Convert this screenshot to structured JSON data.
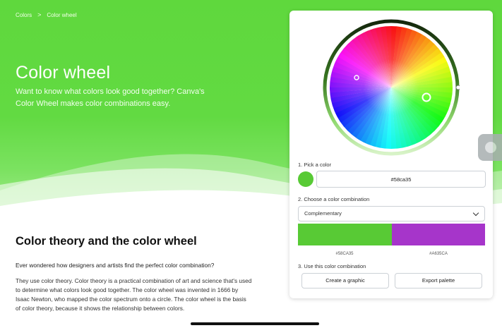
{
  "breadcrumb": {
    "root": "Colors",
    "separator": ">",
    "current": "Color wheel"
  },
  "hero": {
    "title": "Color wheel",
    "subtitle": "Want to know what colors look good together? Canva's Color Wheel makes color combinations easy."
  },
  "theory": {
    "title": "Color theory and the color wheel",
    "intro": "Ever wondered how designers and artists find the perfect color combination?",
    "body": "They use color theory. Color theory is a practical combination of art and science that's used to determine what colors look good together. The color wheel was invented in 1666 by Isaac Newton, who mapped the color spectrum onto a circle. The color wheel is the basis of color theory, because it shows the relationship between colors."
  },
  "picker": {
    "step1_label": "1. Pick a color",
    "hex_value": "#58ca35",
    "swatch_color": "#58ca35",
    "step2_label": "2. Choose a color combination",
    "combination_selected": "Complementary",
    "palette": [
      {
        "hex": "#58CA35",
        "color": "#58ca35"
      },
      {
        "hex": "#A635CA",
        "color": "#a635ca"
      }
    ],
    "step3_label": "3. Use this color combination",
    "create_button": "Create a graphic",
    "export_button": "Export palette"
  },
  "colors": {
    "hero_green": "#5fd83d",
    "ring_dark": "#1f3d13"
  }
}
